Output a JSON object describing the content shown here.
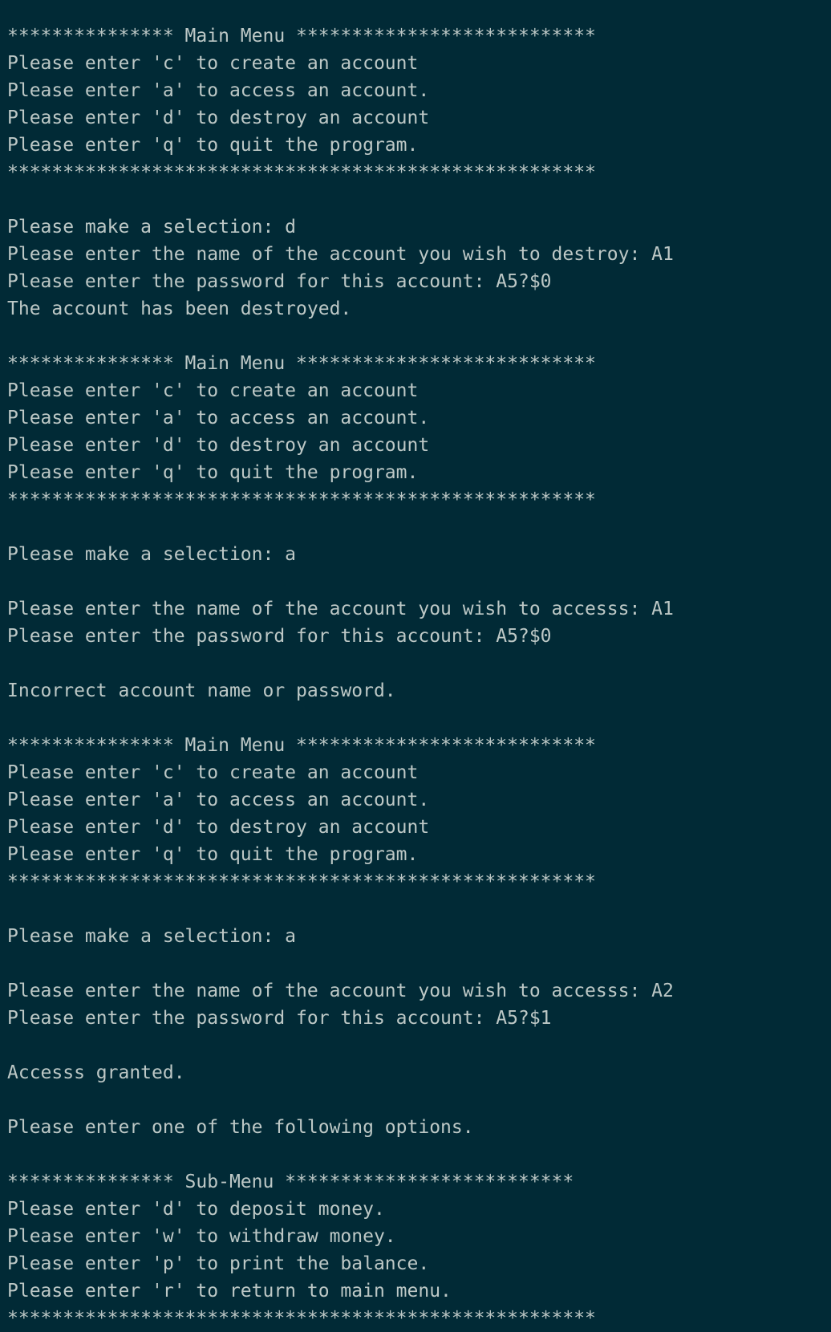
{
  "terminal": {
    "background": "#012a36",
    "foreground": "#bdc8c6",
    "lines": [
      "*************** Main Menu ***************************",
      "Please enter 'c' to create an account",
      "Please enter 'a' to access an account.",
      "Please enter 'd' to destroy an account",
      "Please enter 'q' to quit the program.",
      "*****************************************************",
      "",
      "Please make a selection: d",
      "Please enter the name of the account you wish to destroy: A1",
      "Please enter the password for this account: A5?$0",
      "The account has been destroyed.",
      "",
      "*************** Main Menu ***************************",
      "Please enter 'c' to create an account",
      "Please enter 'a' to access an account.",
      "Please enter 'd' to destroy an account",
      "Please enter 'q' to quit the program.",
      "*****************************************************",
      "",
      "Please make a selection: a",
      "",
      "Please enter the name of the account you wish to accesss: A1",
      "Please enter the password for this account: A5?$0",
      "",
      "Incorrect account name or password.",
      "",
      "*************** Main Menu ***************************",
      "Please enter 'c' to create an account",
      "Please enter 'a' to access an account.",
      "Please enter 'd' to destroy an account",
      "Please enter 'q' to quit the program.",
      "*****************************************************",
      "",
      "Please make a selection: a",
      "",
      "Please enter the name of the account you wish to accesss: A2",
      "Please enter the password for this account: A5?$1",
      "",
      "Accesss granted.",
      "",
      "Please enter one of the following options.",
      "",
      "*************** Sub-Menu **************************",
      "Please enter 'd' to deposit money.",
      "Please enter 'w' to withdraw money.",
      "Please enter 'p' to print the balance.",
      "Please enter 'r' to return to main menu.",
      "*****************************************************"
    ]
  }
}
